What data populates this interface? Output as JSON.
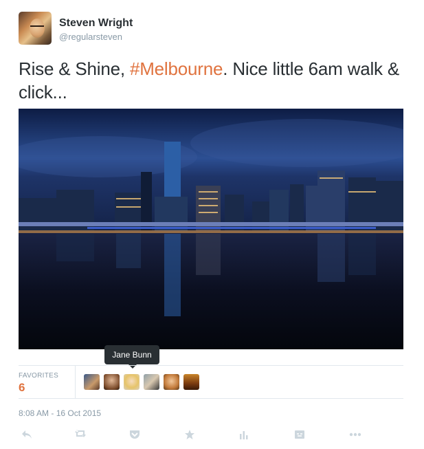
{
  "author": {
    "name": "Steven Wright",
    "handle": "@regularsteven"
  },
  "tweet": {
    "text_before": "Rise & Shine, ",
    "hashtag": "#Melbourne",
    "text_after": ". Nice little 6am walk & click..."
  },
  "tooltip": "Jane Bunn",
  "stats": {
    "favorites_label": "FAVORITES",
    "favorites_count": "6"
  },
  "timestamp": "8:08 AM - 16 Oct 2015",
  "actions": [
    "reply-icon",
    "retweet-icon",
    "pocket-icon",
    "favorite-icon",
    "analytics-icon",
    "embed-icon",
    "more-icon"
  ],
  "colors": {
    "hashtag": "#e0733f",
    "count": "#e0733f",
    "muted": "#8899a6",
    "action": "#ccd6dd"
  }
}
